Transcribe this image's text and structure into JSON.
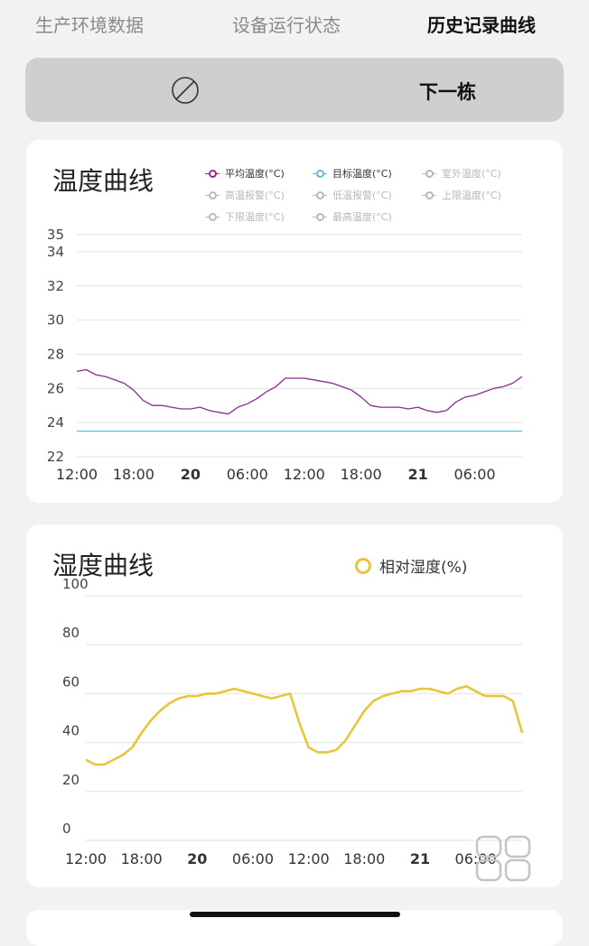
{
  "tabs": [
    {
      "label": "生产环境数据"
    },
    {
      "label": "设备运行状态"
    },
    {
      "label": "历史记录曲线"
    }
  ],
  "active_tab": 2,
  "building_bar": {
    "next_label": "下一栋",
    "icon": "ban-icon"
  },
  "temperature_card": {
    "title": "温度曲线",
    "legend": [
      {
        "label": "平均温度(°C)",
        "enabled": true,
        "color": "#8e2a8e"
      },
      {
        "label": "目标温度(°C)",
        "enabled": true,
        "color": "#5bc0cf"
      },
      {
        "label": "室外温度(°C)",
        "enabled": false
      },
      {
        "label": "高温报警(°C)",
        "enabled": false
      },
      {
        "label": "低温报警(°C)",
        "enabled": false
      },
      {
        "label": "上限温度(°C)",
        "enabled": false
      },
      {
        "label": "下限温度(°C)",
        "enabled": false
      },
      {
        "label": "最高温度(°C)",
        "enabled": false
      }
    ]
  },
  "humidity_card": {
    "title": "湿度曲线",
    "legend_label": "相对湿度(%)",
    "icon": "grid-view-icon"
  },
  "chart_data": [
    {
      "type": "line",
      "title": "温度曲线",
      "x_tick_labels": [
        "12:00",
        "18:00",
        "20",
        "06:00",
        "12:00",
        "18:00",
        "21",
        "06:00"
      ],
      "x_tick_bold": [
        false,
        false,
        true,
        false,
        false,
        false,
        true,
        false
      ],
      "x_tick_hours": [
        0,
        6,
        12,
        18,
        24,
        30,
        36,
        42
      ],
      "x_range": [
        0,
        47
      ],
      "ylim": [
        22,
        35
      ],
      "y_ticks": [
        22,
        24,
        26,
        28,
        30,
        32,
        34,
        35
      ],
      "grid": true,
      "legend_position": "top-right",
      "series": [
        {
          "name": "平均温度(°C)",
          "color": "#8e2a8e",
          "x": [
            0,
            1,
            2,
            3,
            4,
            5,
            6,
            7,
            8,
            9,
            10,
            11,
            12,
            13,
            14,
            15,
            16,
            17,
            18,
            19,
            20,
            21,
            22,
            23,
            24,
            25,
            26,
            27,
            28,
            29,
            30,
            31,
            32,
            33,
            34,
            35,
            36,
            37,
            38,
            39,
            40,
            41,
            42,
            43,
            44,
            45,
            46,
            47
          ],
          "y": [
            27.0,
            27.1,
            26.8,
            26.7,
            26.5,
            26.3,
            25.9,
            25.3,
            25.0,
            25.0,
            24.9,
            24.8,
            24.8,
            24.9,
            24.7,
            24.6,
            24.5,
            24.9,
            25.1,
            25.4,
            25.8,
            26.1,
            26.6,
            26.6,
            26.6,
            26.5,
            26.4,
            26.3,
            26.1,
            25.9,
            25.5,
            25.0,
            24.9,
            24.9,
            24.9,
            24.8,
            24.9,
            24.7,
            24.6,
            24.7,
            25.2,
            25.5,
            25.6,
            25.8,
            26.0,
            26.1,
            26.3,
            26.7
          ]
        },
        {
          "name": "目标温度(°C)",
          "color": "#5bc0cf",
          "x": [
            0,
            47
          ],
          "y": [
            23.5,
            23.5
          ]
        }
      ]
    },
    {
      "type": "line",
      "title": "湿度曲线",
      "x_tick_labels": [
        "12:00",
        "18:00",
        "20",
        "06:00",
        "12:00",
        "18:00",
        "21",
        "06:00"
      ],
      "x_tick_bold": [
        false,
        false,
        true,
        false,
        false,
        false,
        true,
        false
      ],
      "x_tick_hours": [
        0,
        6,
        12,
        18,
        24,
        30,
        36,
        42
      ],
      "x_range": [
        0,
        47
      ],
      "ylim": [
        0,
        100
      ],
      "y_ticks": [
        0,
        20,
        40,
        60,
        80,
        100
      ],
      "grid": true,
      "legend_position": "top-right",
      "series": [
        {
          "name": "相对湿度(%)",
          "color": "#e8c53a",
          "x": [
            0,
            1,
            2,
            3,
            4,
            5,
            6,
            7,
            8,
            9,
            10,
            11,
            12,
            13,
            14,
            15,
            16,
            17,
            18,
            19,
            20,
            21,
            22,
            23,
            24,
            25,
            26,
            27,
            28,
            29,
            30,
            31,
            32,
            33,
            34,
            35,
            36,
            37,
            38,
            39,
            40,
            41,
            42,
            43,
            44,
            45,
            46,
            47
          ],
          "y": [
            33,
            31,
            31,
            33,
            35,
            38,
            44,
            49,
            53,
            56,
            58,
            59,
            59,
            60,
            60,
            61,
            62,
            61,
            60,
            59,
            58,
            59,
            60,
            48,
            38,
            36,
            36,
            37,
            41,
            47,
            53,
            57,
            59,
            60,
            61,
            61,
            62,
            62,
            61,
            60,
            62,
            63,
            61,
            59,
            59,
            59,
            57,
            44
          ]
        }
      ]
    }
  ]
}
